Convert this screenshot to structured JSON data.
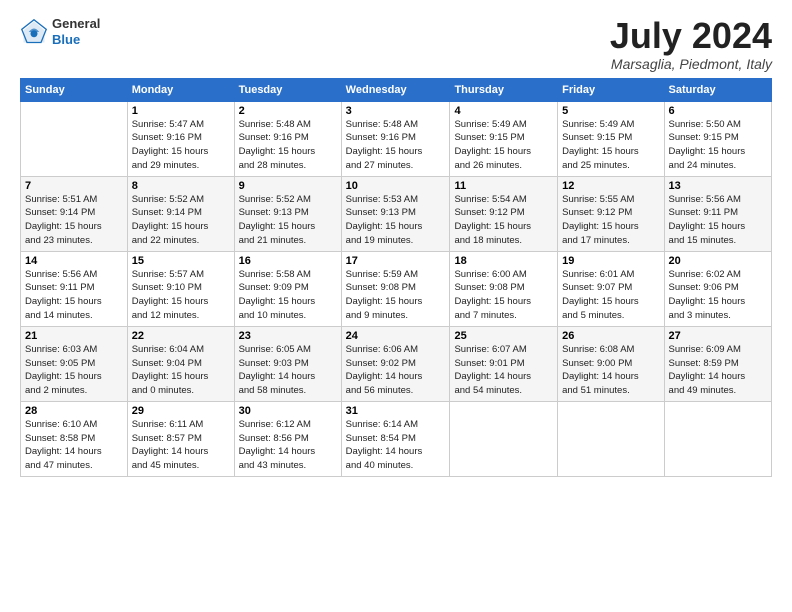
{
  "logo": {
    "general": "General",
    "blue": "Blue"
  },
  "title": "July 2024",
  "location": "Marsaglia, Piedmont, Italy",
  "days_header": [
    "Sunday",
    "Monday",
    "Tuesday",
    "Wednesday",
    "Thursday",
    "Friday",
    "Saturday"
  ],
  "weeks": [
    [
      {
        "day": "",
        "info": ""
      },
      {
        "day": "1",
        "info": "Sunrise: 5:47 AM\nSunset: 9:16 PM\nDaylight: 15 hours\nand 29 minutes."
      },
      {
        "day": "2",
        "info": "Sunrise: 5:48 AM\nSunset: 9:16 PM\nDaylight: 15 hours\nand 28 minutes."
      },
      {
        "day": "3",
        "info": "Sunrise: 5:48 AM\nSunset: 9:16 PM\nDaylight: 15 hours\nand 27 minutes."
      },
      {
        "day": "4",
        "info": "Sunrise: 5:49 AM\nSunset: 9:15 PM\nDaylight: 15 hours\nand 26 minutes."
      },
      {
        "day": "5",
        "info": "Sunrise: 5:49 AM\nSunset: 9:15 PM\nDaylight: 15 hours\nand 25 minutes."
      },
      {
        "day": "6",
        "info": "Sunrise: 5:50 AM\nSunset: 9:15 PM\nDaylight: 15 hours\nand 24 minutes."
      }
    ],
    [
      {
        "day": "7",
        "info": "Sunrise: 5:51 AM\nSunset: 9:14 PM\nDaylight: 15 hours\nand 23 minutes."
      },
      {
        "day": "8",
        "info": "Sunrise: 5:52 AM\nSunset: 9:14 PM\nDaylight: 15 hours\nand 22 minutes."
      },
      {
        "day": "9",
        "info": "Sunrise: 5:52 AM\nSunset: 9:13 PM\nDaylight: 15 hours\nand 21 minutes."
      },
      {
        "day": "10",
        "info": "Sunrise: 5:53 AM\nSunset: 9:13 PM\nDaylight: 15 hours\nand 19 minutes."
      },
      {
        "day": "11",
        "info": "Sunrise: 5:54 AM\nSunset: 9:12 PM\nDaylight: 15 hours\nand 18 minutes."
      },
      {
        "day": "12",
        "info": "Sunrise: 5:55 AM\nSunset: 9:12 PM\nDaylight: 15 hours\nand 17 minutes."
      },
      {
        "day": "13",
        "info": "Sunrise: 5:56 AM\nSunset: 9:11 PM\nDaylight: 15 hours\nand 15 minutes."
      }
    ],
    [
      {
        "day": "14",
        "info": "Sunrise: 5:56 AM\nSunset: 9:11 PM\nDaylight: 15 hours\nand 14 minutes."
      },
      {
        "day": "15",
        "info": "Sunrise: 5:57 AM\nSunset: 9:10 PM\nDaylight: 15 hours\nand 12 minutes."
      },
      {
        "day": "16",
        "info": "Sunrise: 5:58 AM\nSunset: 9:09 PM\nDaylight: 15 hours\nand 10 minutes."
      },
      {
        "day": "17",
        "info": "Sunrise: 5:59 AM\nSunset: 9:08 PM\nDaylight: 15 hours\nand 9 minutes."
      },
      {
        "day": "18",
        "info": "Sunrise: 6:00 AM\nSunset: 9:08 PM\nDaylight: 15 hours\nand 7 minutes."
      },
      {
        "day": "19",
        "info": "Sunrise: 6:01 AM\nSunset: 9:07 PM\nDaylight: 15 hours\nand 5 minutes."
      },
      {
        "day": "20",
        "info": "Sunrise: 6:02 AM\nSunset: 9:06 PM\nDaylight: 15 hours\nand 3 minutes."
      }
    ],
    [
      {
        "day": "21",
        "info": "Sunrise: 6:03 AM\nSunset: 9:05 PM\nDaylight: 15 hours\nand 2 minutes."
      },
      {
        "day": "22",
        "info": "Sunrise: 6:04 AM\nSunset: 9:04 PM\nDaylight: 15 hours\nand 0 minutes."
      },
      {
        "day": "23",
        "info": "Sunrise: 6:05 AM\nSunset: 9:03 PM\nDaylight: 14 hours\nand 58 minutes."
      },
      {
        "day": "24",
        "info": "Sunrise: 6:06 AM\nSunset: 9:02 PM\nDaylight: 14 hours\nand 56 minutes."
      },
      {
        "day": "25",
        "info": "Sunrise: 6:07 AM\nSunset: 9:01 PM\nDaylight: 14 hours\nand 54 minutes."
      },
      {
        "day": "26",
        "info": "Sunrise: 6:08 AM\nSunset: 9:00 PM\nDaylight: 14 hours\nand 51 minutes."
      },
      {
        "day": "27",
        "info": "Sunrise: 6:09 AM\nSunset: 8:59 PM\nDaylight: 14 hours\nand 49 minutes."
      }
    ],
    [
      {
        "day": "28",
        "info": "Sunrise: 6:10 AM\nSunset: 8:58 PM\nDaylight: 14 hours\nand 47 minutes."
      },
      {
        "day": "29",
        "info": "Sunrise: 6:11 AM\nSunset: 8:57 PM\nDaylight: 14 hours\nand 45 minutes."
      },
      {
        "day": "30",
        "info": "Sunrise: 6:12 AM\nSunset: 8:56 PM\nDaylight: 14 hours\nand 43 minutes."
      },
      {
        "day": "31",
        "info": "Sunrise: 6:14 AM\nSunset: 8:54 PM\nDaylight: 14 hours\nand 40 minutes."
      },
      {
        "day": "",
        "info": ""
      },
      {
        "day": "",
        "info": ""
      },
      {
        "day": "",
        "info": ""
      }
    ]
  ]
}
